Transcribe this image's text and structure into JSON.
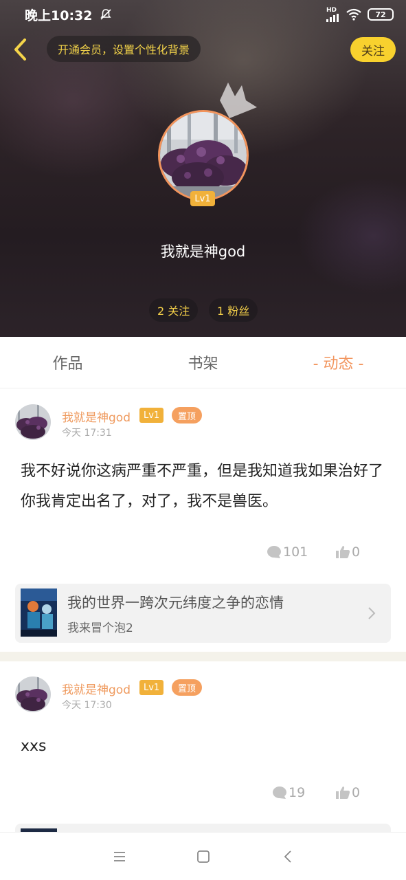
{
  "status_bar": {
    "time": "晚上10:32",
    "network": "HD",
    "battery": "72"
  },
  "header": {
    "vip_prompt": "开通会员，设置个性化背景",
    "follow_label": "关注",
    "level": "Lv1",
    "user_name": "我就是神god",
    "following": "2 关注",
    "fans": "1 粉丝"
  },
  "tabs": [
    {
      "label": "作品"
    },
    {
      "label": "书架"
    },
    {
      "label": "- 动态 -",
      "active": true
    }
  ],
  "posts": [
    {
      "author": "我就是神god",
      "level": "Lv1",
      "pinned_label": "置顶",
      "time": "今天 17:31",
      "content": "我不好说你这病严重不严重，但是我知道我如果治好了你我肯定出名了，对了，我不是兽医。",
      "comments": "101",
      "likes": "0",
      "linked": {
        "title": "我的世界一跨次元纬度之争的恋情",
        "subtitle": "我来冒个泡2"
      }
    },
    {
      "author": "我就是神god",
      "level": "Lv1",
      "pinned_label": "置顶",
      "time": "今天 17:30",
      "content": "xxs",
      "comments": "19",
      "likes": "0"
    }
  ],
  "colors": {
    "accent": "#f2945c",
    "follow_button": "#f8d12e",
    "level_badge": "#f1b13a",
    "stat_text": "#f3cf49"
  },
  "icons": [
    "back-arrow-icon",
    "crown-icon",
    "comment-icon",
    "like-icon",
    "chevron-right-icon",
    "menu-icon",
    "home-icon",
    "back-icon"
  ]
}
